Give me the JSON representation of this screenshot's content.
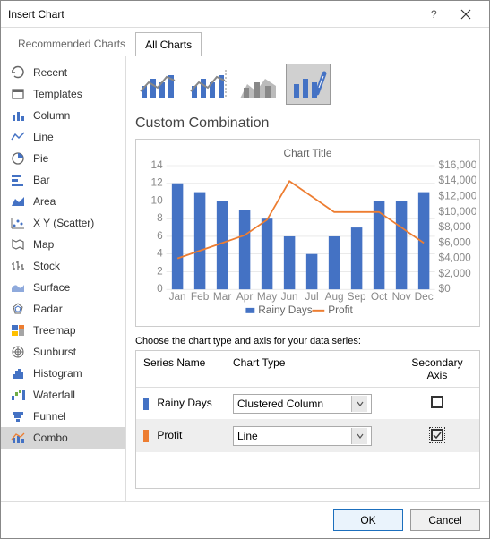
{
  "window": {
    "title": "Insert Chart"
  },
  "tabs": {
    "recommended": "Recommended Charts",
    "all": "All Charts"
  },
  "sidebar": {
    "items": [
      {
        "label": "Recent",
        "name": "recent"
      },
      {
        "label": "Templates",
        "name": "templates"
      },
      {
        "label": "Column",
        "name": "column"
      },
      {
        "label": "Line",
        "name": "line"
      },
      {
        "label": "Pie",
        "name": "pie"
      },
      {
        "label": "Bar",
        "name": "bar"
      },
      {
        "label": "Area",
        "name": "area"
      },
      {
        "label": "X Y (Scatter)",
        "name": "scatter"
      },
      {
        "label": "Map",
        "name": "map"
      },
      {
        "label": "Stock",
        "name": "stock"
      },
      {
        "label": "Surface",
        "name": "surface"
      },
      {
        "label": "Radar",
        "name": "radar"
      },
      {
        "label": "Treemap",
        "name": "treemap"
      },
      {
        "label": "Sunburst",
        "name": "sunburst"
      },
      {
        "label": "Histogram",
        "name": "histogram"
      },
      {
        "label": "Waterfall",
        "name": "waterfall"
      },
      {
        "label": "Funnel",
        "name": "funnel"
      },
      {
        "label": "Combo",
        "name": "combo"
      }
    ]
  },
  "heading": "Custom Combination",
  "chart_data": {
    "type": "combo",
    "title": "Chart Title",
    "categories": [
      "Jan",
      "Feb",
      "Mar",
      "Apr",
      "May",
      "Jun",
      "Jul",
      "Aug",
      "Sep",
      "Oct",
      "Nov",
      "Dec"
    ],
    "series": [
      {
        "name": "Rainy Days",
        "type": "bar",
        "axis": "primary",
        "color": "#4472C4",
        "values": [
          12,
          11,
          10,
          9,
          8,
          6,
          4,
          6,
          7,
          10,
          10,
          11
        ]
      },
      {
        "name": "Profit",
        "type": "line",
        "axis": "secondary",
        "color": "#ED7D31",
        "values": [
          4000,
          5000,
          6000,
          7000,
          9000,
          14000,
          12000,
          10000,
          10000,
          10000,
          8000,
          6000
        ]
      }
    ],
    "primary_axis": {
      "min": 0,
      "max": 14,
      "step": 2,
      "ticks": [
        "0",
        "2",
        "4",
        "6",
        "8",
        "10",
        "12",
        "14"
      ]
    },
    "secondary_axis": {
      "min": 0,
      "max": 16000,
      "step": 2000,
      "ticks": [
        "$0",
        "$2,000",
        "$4,000",
        "$6,000",
        "$8,000",
        "$10,000",
        "$12,000",
        "$14,000",
        "$16,000"
      ]
    },
    "legend": [
      "Rainy Days",
      "Profit"
    ]
  },
  "series_section": {
    "prompt": "Choose the chart type and axis for your data series:",
    "headers": {
      "name": "Series Name",
      "type": "Chart Type",
      "secondary": "Secondary Axis"
    },
    "rows": [
      {
        "swatch": "#4472C4",
        "name": "Rainy Days",
        "type": "Clustered Column",
        "secondary": false
      },
      {
        "swatch": "#ED7D31",
        "name": "Profit",
        "type": "Line",
        "secondary": true
      }
    ]
  },
  "buttons": {
    "ok": "OK",
    "cancel": "Cancel"
  }
}
